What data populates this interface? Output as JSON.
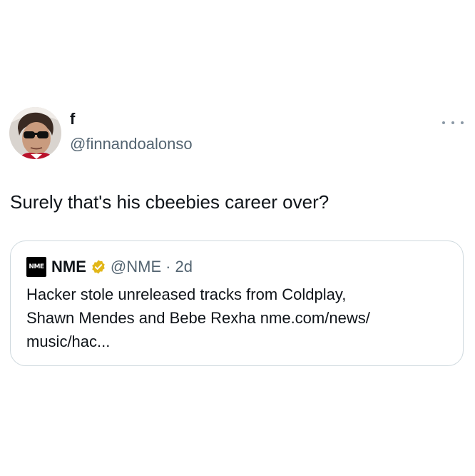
{
  "tweet": {
    "author": {
      "display_name": "f",
      "handle": "@finnandoalonso"
    },
    "text": "Surely that's his cbeebies career over?"
  },
  "quoted_tweet": {
    "logo_text": "NME",
    "display_name": "NME",
    "verified": true,
    "handle": "@NME",
    "separator": "·",
    "time": "2d",
    "text_line1": "Hacker stole unreleased tracks from Coldplay,",
    "text_line2": "Shawn Mendes and Bebe Rexha nme.com/news/",
    "text_line3": "music/hac..."
  },
  "icons": {
    "more": "more-horizontal-icon",
    "verified": "verified-badge-icon"
  },
  "colors": {
    "text_primary": "#0f1419",
    "text_secondary": "#536471",
    "border": "#cfd9de",
    "verified_gold": "#e2b719"
  }
}
